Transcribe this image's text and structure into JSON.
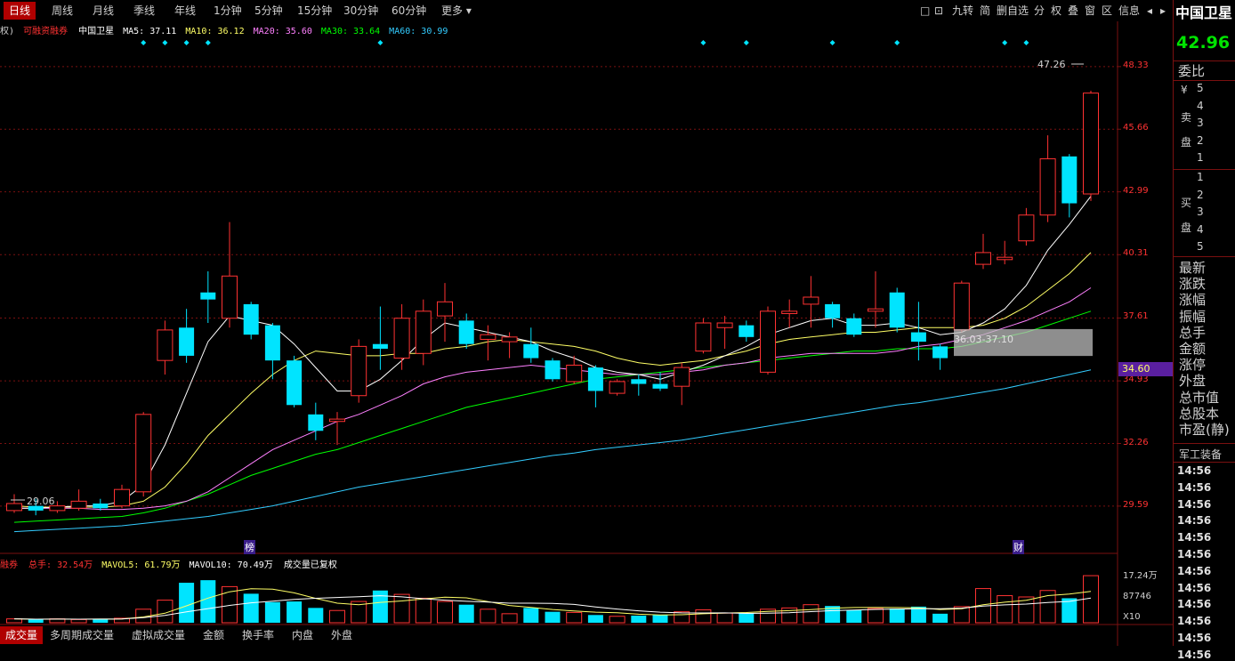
{
  "top_tabs": [
    "日线",
    "周线",
    "月线",
    "季线",
    "年线",
    "1分钟",
    "5分钟",
    "15分钟",
    "30分钟",
    "60分钟",
    "更多 ▾"
  ],
  "top_icons": [
    "□",
    "⊡",
    "九转",
    "简",
    "删自选",
    "分",
    "权",
    "叠",
    "窗",
    "区",
    "信息",
    "◂",
    "▸"
  ],
  "legend": {
    "prefix": "权)",
    "margin_label": "可融资融券",
    "name": "中国卫星",
    "ma5": "MA5: 37.11",
    "ma10": "MA10: 36.12",
    "ma20": "MA20: 35.60",
    "ma30": "MA30: 33.64",
    "ma60": "MA60: 30.99"
  },
  "colors": {
    "up": "#ff3232",
    "down": "#00e4ff",
    "ma5": "#ffffff",
    "ma10": "#ffff66",
    "ma20": "#ff80ff",
    "ma30": "#00ff00",
    "ma60": "#33ccff",
    "grid": "#7a1010",
    "last_price_bg": "#5a1fa0"
  },
  "price_axis": [
    "48.33",
    "45.66",
    "42.99",
    "40.31",
    "37.61",
    "34.93",
    "32.26",
    "29.59"
  ],
  "last_price_tag": "34.60",
  "high_label": "47.26",
  "low_label": "29.06",
  "range_box_label": "36.03-37.10",
  "markers": {
    "bang": "榜",
    "cai": "财"
  },
  "volume_legend": {
    "prefix": "融券",
    "total": "总手: 32.54万",
    "mavol5": "MAVOL5: 61.79万",
    "mavol10": "MAVOL10: 70.49万",
    "note": "成交量已复权"
  },
  "volume_axis": [
    "17.24万",
    "87746",
    "X10"
  ],
  "bottom_tabs": [
    "成交量",
    "多周期成交量",
    "虚拟成交量",
    "金额",
    "换手率",
    "内盘",
    "外盘"
  ],
  "right_panel": {
    "stock_name": "中国卫星",
    "price": "42.96",
    "weibi": "委比",
    "sell_label": "卖盘",
    "buy_label": "买盘",
    "yen": "¥",
    "sell_levels": [
      "5",
      "4",
      "3",
      "2",
      "1"
    ],
    "buy_levels": [
      "1",
      "2",
      "3",
      "4",
      "5"
    ],
    "fields": [
      "最新",
      "涨跌",
      "涨幅",
      "振幅",
      "总手",
      "金额",
      "涨停",
      "外盘",
      "总市值",
      "总股本",
      "市盈(静)"
    ],
    "sector": "军工装备",
    "times": [
      "14:56",
      "14:56",
      "14:56",
      "14:56",
      "14:56",
      "14:56",
      "14:56",
      "14:56",
      "14:56",
      "14:56",
      "14:56",
      "14:56"
    ]
  },
  "chart_data": {
    "type": "candlestick",
    "price_range": [
      27.5,
      49.5
    ],
    "candles": [
      {
        "o": 29.4,
        "c": 29.7,
        "h": 30.1,
        "l": 29.3
      },
      {
        "o": 29.6,
        "c": 29.4,
        "h": 29.9,
        "l": 29.2
      },
      {
        "o": 29.4,
        "c": 29.6,
        "h": 29.8,
        "l": 29.3
      },
      {
        "o": 29.5,
        "c": 29.8,
        "h": 30.3,
        "l": 29.4
      },
      {
        "o": 29.7,
        "c": 29.5,
        "h": 29.9,
        "l": 29.4
      },
      {
        "o": 29.6,
        "c": 30.3,
        "h": 30.5,
        "l": 29.5
      },
      {
        "o": 30.2,
        "c": 33.5,
        "h": 33.6,
        "l": 30.0
      },
      {
        "o": 35.8,
        "c": 37.1,
        "h": 37.5,
        "l": 35.2
      },
      {
        "o": 37.2,
        "c": 36.0,
        "h": 38.0,
        "l": 35.7
      },
      {
        "o": 38.7,
        "c": 38.4,
        "h": 39.6,
        "l": 37.4
      },
      {
        "o": 37.6,
        "c": 39.4,
        "h": 41.7,
        "l": 37.2
      },
      {
        "o": 38.2,
        "c": 36.9,
        "h": 38.3,
        "l": 36.7
      },
      {
        "o": 37.3,
        "c": 35.8,
        "h": 37.4,
        "l": 35.0
      },
      {
        "o": 35.8,
        "c": 33.9,
        "h": 36.0,
        "l": 33.8
      },
      {
        "o": 33.5,
        "c": 32.8,
        "h": 34.0,
        "l": 32.4
      },
      {
        "o": 33.2,
        "c": 33.3,
        "h": 33.6,
        "l": 32.2
      },
      {
        "o": 34.3,
        "c": 36.4,
        "h": 36.7,
        "l": 34.0
      },
      {
        "o": 36.5,
        "c": 36.3,
        "h": 38.1,
        "l": 35.4
      },
      {
        "o": 35.9,
        "c": 37.6,
        "h": 38.2,
        "l": 35.4
      },
      {
        "o": 36.1,
        "c": 37.9,
        "h": 38.4,
        "l": 35.6
      },
      {
        "o": 37.7,
        "c": 38.3,
        "h": 39.1,
        "l": 36.6
      },
      {
        "o": 37.5,
        "c": 36.5,
        "h": 37.8,
        "l": 36.3
      },
      {
        "o": 36.7,
        "c": 36.9,
        "h": 37.3,
        "l": 35.8
      },
      {
        "o": 36.6,
        "c": 36.8,
        "h": 37.0,
        "l": 35.9
      },
      {
        "o": 36.5,
        "c": 35.9,
        "h": 37.2,
        "l": 35.7
      },
      {
        "o": 35.8,
        "c": 35.0,
        "h": 35.9,
        "l": 34.9
      },
      {
        "o": 34.9,
        "c": 35.6,
        "h": 36.0,
        "l": 34.8
      },
      {
        "o": 35.5,
        "c": 34.5,
        "h": 35.6,
        "l": 33.8
      },
      {
        "o": 34.4,
        "c": 34.9,
        "h": 35.0,
        "l": 34.3
      },
      {
        "o": 35.0,
        "c": 34.8,
        "h": 35.2,
        "l": 34.3
      },
      {
        "o": 34.8,
        "c": 34.6,
        "h": 35.3,
        "l": 34.5
      },
      {
        "o": 34.7,
        "c": 35.5,
        "h": 35.7,
        "l": 33.9
      },
      {
        "o": 36.2,
        "c": 37.4,
        "h": 37.6,
        "l": 36.1
      },
      {
        "o": 37.2,
        "c": 37.4,
        "h": 37.7,
        "l": 36.3
      },
      {
        "o": 37.3,
        "c": 36.8,
        "h": 37.5,
        "l": 36.6
      },
      {
        "o": 35.3,
        "c": 37.9,
        "h": 38.1,
        "l": 35.2
      },
      {
        "o": 37.8,
        "c": 37.9,
        "h": 38.4,
        "l": 37.2
      },
      {
        "o": 38.2,
        "c": 38.5,
        "h": 39.4,
        "l": 37.2
      },
      {
        "o": 38.2,
        "c": 37.6,
        "h": 38.3,
        "l": 37.2
      },
      {
        "o": 37.6,
        "c": 36.9,
        "h": 37.8,
        "l": 36.8
      },
      {
        "o": 37.9,
        "c": 38.0,
        "h": 39.6,
        "l": 37.2
      },
      {
        "o": 38.7,
        "c": 37.2,
        "h": 38.9,
        "l": 37.0
      },
      {
        "o": 37.0,
        "c": 36.6,
        "h": 38.3,
        "l": 35.8
      },
      {
        "o": 36.4,
        "c": 35.9,
        "h": 36.5,
        "l": 35.4
      },
      {
        "o": 37.1,
        "c": 39.1,
        "h": 39.2,
        "l": 37.0
      },
      {
        "o": 39.9,
        "c": 40.4,
        "h": 41.2,
        "l": 39.7
      },
      {
        "o": 40.1,
        "c": 40.2,
        "h": 40.9,
        "l": 39.9
      },
      {
        "o": 40.9,
        "c": 42.0,
        "h": 42.3,
        "l": 40.7
      },
      {
        "o": 42.0,
        "c": 44.4,
        "h": 45.4,
        "l": 41.7
      },
      {
        "o": 44.5,
        "c": 42.5,
        "h": 44.6,
        "l": 41.9
      },
      {
        "o": 42.9,
        "c": 47.2,
        "h": 47.3,
        "l": 42.6
      }
    ],
    "ma": {
      "ma5": [
        29.5,
        29.5,
        29.55,
        29.6,
        29.6,
        29.8,
        30.5,
        32.2,
        34.4,
        36.6,
        37.7,
        37.5,
        37.3,
        36.5,
        35.5,
        34.5,
        34.5,
        35.0,
        35.8,
        36.7,
        37.4,
        37.2,
        37.0,
        36.8,
        36.6,
        36.2,
        35.9,
        35.5,
        35.3,
        35.2,
        35.0,
        35.3,
        35.6,
        36.0,
        36.4,
        36.9,
        37.2,
        37.5,
        37.6,
        37.3,
        37.3,
        37.4,
        37.2,
        36.9,
        37.0,
        37.4,
        38.0,
        39.0,
        40.5,
        41.6,
        42.8
      ],
      "ma10": [
        29.6,
        29.55,
        29.55,
        29.55,
        29.55,
        29.6,
        29.8,
        30.4,
        31.4,
        32.6,
        33.5,
        34.4,
        35.2,
        35.8,
        36.2,
        36.1,
        36.0,
        36.0,
        36.1,
        36.1,
        36.3,
        36.4,
        36.6,
        36.7,
        36.6,
        36.5,
        36.4,
        36.2,
        35.9,
        35.7,
        35.6,
        35.7,
        35.8,
        36.0,
        36.2,
        36.5,
        36.7,
        36.8,
        36.9,
        37.0,
        37.0,
        37.1,
        37.2,
        37.2,
        37.2,
        37.3,
        37.6,
        38.1,
        38.8,
        39.5,
        40.4
      ],
      "ma20": [
        29.5,
        29.5,
        29.5,
        29.5,
        29.45,
        29.45,
        29.5,
        29.6,
        29.8,
        30.2,
        30.8,
        31.4,
        32.0,
        32.4,
        32.8,
        33.2,
        33.5,
        33.9,
        34.3,
        34.8,
        35.1,
        35.3,
        35.4,
        35.5,
        35.6,
        35.5,
        35.4,
        35.3,
        35.2,
        35.2,
        35.2,
        35.3,
        35.4,
        35.6,
        35.7,
        35.9,
        36.0,
        36.1,
        36.1,
        36.1,
        36.1,
        36.2,
        36.4,
        36.5,
        36.7,
        36.9,
        37.2,
        37.5,
        37.9,
        38.3,
        38.9
      ],
      "ma30": [
        28.9,
        28.95,
        29.0,
        29.05,
        29.1,
        29.15,
        29.3,
        29.5,
        29.8,
        30.1,
        30.5,
        30.9,
        31.2,
        31.5,
        31.8,
        32.0,
        32.3,
        32.6,
        32.9,
        33.2,
        33.5,
        33.8,
        34.0,
        34.2,
        34.4,
        34.6,
        34.8,
        35.0,
        35.1,
        35.2,
        35.3,
        35.4,
        35.5,
        35.6,
        35.7,
        35.8,
        35.9,
        36.0,
        36.1,
        36.2,
        36.2,
        36.3,
        36.3,
        36.3,
        36.4,
        36.6,
        36.8,
        37.0,
        37.3,
        37.6,
        37.9
      ],
      "ma60": [
        28.5,
        28.55,
        28.6,
        28.65,
        28.7,
        28.75,
        28.85,
        28.95,
        29.05,
        29.15,
        29.3,
        29.45,
        29.6,
        29.8,
        30.0,
        30.2,
        30.4,
        30.55,
        30.7,
        30.85,
        31.0,
        31.15,
        31.3,
        31.45,
        31.6,
        31.75,
        31.85,
        32.0,
        32.1,
        32.2,
        32.3,
        32.4,
        32.55,
        32.7,
        32.85,
        33.0,
        33.15,
        33.3,
        33.45,
        33.6,
        33.75,
        33.9,
        34.0,
        34.15,
        34.3,
        34.45,
        34.6,
        34.8,
        35.0,
        35.2,
        35.4
      ]
    },
    "volume": [
      0.06,
      0.05,
      0.06,
      0.05,
      0.06,
      0.07,
      0.21,
      0.35,
      0.62,
      0.66,
      0.56,
      0.45,
      0.32,
      0.33,
      0.23,
      0.19,
      0.33,
      0.5,
      0.44,
      0.38,
      0.33,
      0.28,
      0.21,
      0.14,
      0.23,
      0.17,
      0.16,
      0.12,
      0.1,
      0.11,
      0.12,
      0.17,
      0.2,
      0.15,
      0.15,
      0.21,
      0.23,
      0.28,
      0.26,
      0.2,
      0.22,
      0.22,
      0.25,
      0.14,
      0.25,
      0.53,
      0.42,
      0.4,
      0.5,
      0.38,
      0.73
    ],
    "volume_max": 0.8,
    "diamond_markers_candle_index": [
      6,
      7,
      8,
      9,
      17,
      32,
      34,
      38,
      41,
      46,
      47
    ]
  }
}
